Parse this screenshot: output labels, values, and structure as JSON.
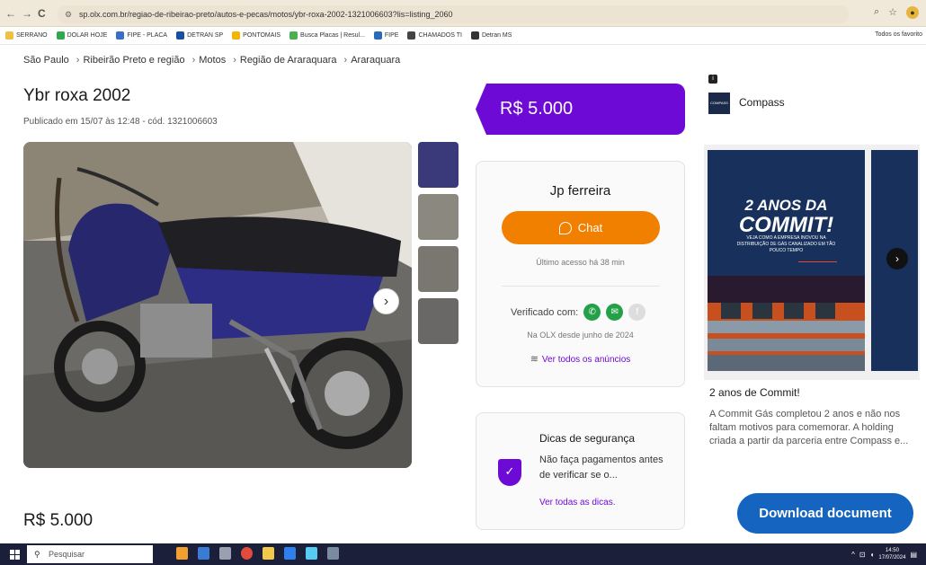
{
  "browser": {
    "nav": {
      "back": "←",
      "forward": "→",
      "reload": "C"
    },
    "url": "sp.olx.com.br/regiao-de-ribeirao-preto/autos-e-pecas/motos/ybr-roxa-2002-1321006603?lis=listing_2060",
    "bookmarks": [
      {
        "label": "SERRANO",
        "color": "#f0c040"
      },
      {
        "label": "DOLAR HOJE",
        "color": "#2fa84f"
      },
      {
        "label": "FIPE - PLACA",
        "color": "#3a6fc4"
      },
      {
        "label": "DETRAN SP",
        "color": "#1a4fa0"
      },
      {
        "label": "PONTOMAIS",
        "color": "#f2b500"
      },
      {
        "label": "Busca Placas | Resul...",
        "color": "#4caf50"
      },
      {
        "label": "FIPE",
        "color": "#2a6bb8"
      },
      {
        "label": "CHAMADOS TI",
        "color": "#444444"
      },
      {
        "label": "Detran MS",
        "color": "#333333"
      }
    ],
    "all_favorites": "Todos os favorito"
  },
  "breadcrumb": [
    "São Paulo",
    "Ribeirão Preto e região",
    "Motos",
    "Região de Araraquara",
    "Araraquara"
  ],
  "breadcrumb_sep": "›",
  "listing": {
    "title": "Ybr roxa 2002",
    "published": "Publicado em 15/07 às 12:48 - cód. 1321006603",
    "price": "R$ 5.000"
  },
  "seller": {
    "name": "Jp ferreira",
    "chat_label": "Chat",
    "last_access": "Último acesso há 38 min",
    "verified_label": "Verificado com:",
    "since": "Na OLX desde junho de 2024",
    "all_ads": "Ver todos os anúncios"
  },
  "safety": {
    "title": "Dicas de segurança",
    "text": "Não faça pagamentos antes de verificar se o...",
    "link": "Ver todas as dicas."
  },
  "ad": {
    "brand": "Compass",
    "headline_1": "2 ANOS DA",
    "headline_2": "COMMIT!",
    "sub": "VEJA COMO A EMPRESA INOVOU NA DISTRIBUIÇÃO DE GÁS CANALIZADO EM TÃO POUCO TEMPO",
    "title": "2 anos de Commit!",
    "description": "A Commit Gás completou 2 anos e não nos faltam motivos para comemorar. A holding criada a partir da parceria entre Compass e...",
    "download": "Download document"
  },
  "taskbar": {
    "search_placeholder": "Pesquisar",
    "time": "14:50",
    "date": "17/07/2024"
  }
}
